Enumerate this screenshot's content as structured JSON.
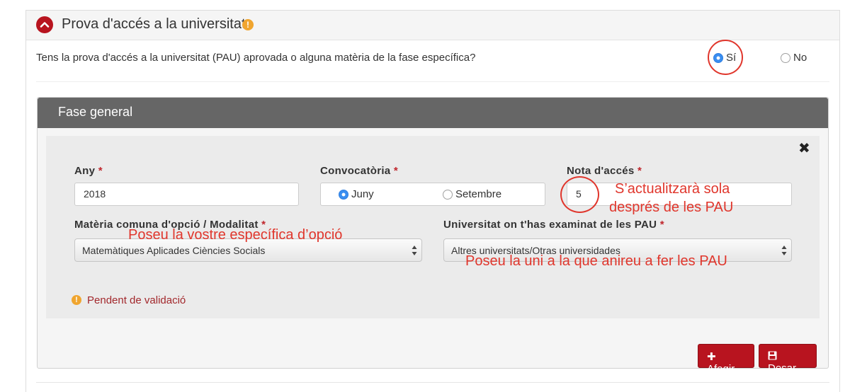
{
  "section": {
    "title": "Prova d'accés a la universitat",
    "warning_icon": "!"
  },
  "question": {
    "text": "Tens la prova d'accés a la universitat (PAU) aprovada o alguna matèria de la fase específica?",
    "options": [
      {
        "label": "Sí",
        "selected": true
      },
      {
        "label": "No",
        "selected": false
      }
    ]
  },
  "panel": {
    "title": "Fase general",
    "close_icon": "✖",
    "fields": {
      "any": {
        "label": "Any",
        "required_mark": "*",
        "value": "2018"
      },
      "convocatoria": {
        "label": "Convocatòria",
        "required_mark": "*",
        "options": [
          {
            "label": "Juny",
            "selected": true
          },
          {
            "label": "Setembre",
            "selected": false
          }
        ]
      },
      "nota": {
        "label": "Nota d'accés",
        "required_mark": "*",
        "value": "5"
      },
      "materia": {
        "label": "Matèria comuna d'opció / Modalitat",
        "required_mark": "*",
        "value": "Matemàtiques Aplicades Ciències Socials"
      },
      "universitat": {
        "label": "Universitat on t'has examinat de les PAU",
        "required_mark": "*",
        "value": "Altres universitats/Otras universidades"
      }
    },
    "status": {
      "icon": "!",
      "text": "Pendent de validació"
    },
    "buttons": {
      "add": {
        "icon": "✚",
        "label": "Afegir"
      },
      "save": {
        "icon": "💾",
        "label": "Desar"
      }
    }
  },
  "annotations": {
    "nota_line1": "S’actualitzarà sola",
    "nota_line2": "després de les PAU",
    "materia": "Poseu la vostre específica d’opció",
    "universitat": "Poseu la uni a la que anireu a fer les PAU"
  },
  "colors": {
    "accent": "#b8141f",
    "annotation": "#e0362c",
    "panel_header": "#666666",
    "warning": "#f0a52f",
    "radio_selected": "#3a8ef0"
  }
}
